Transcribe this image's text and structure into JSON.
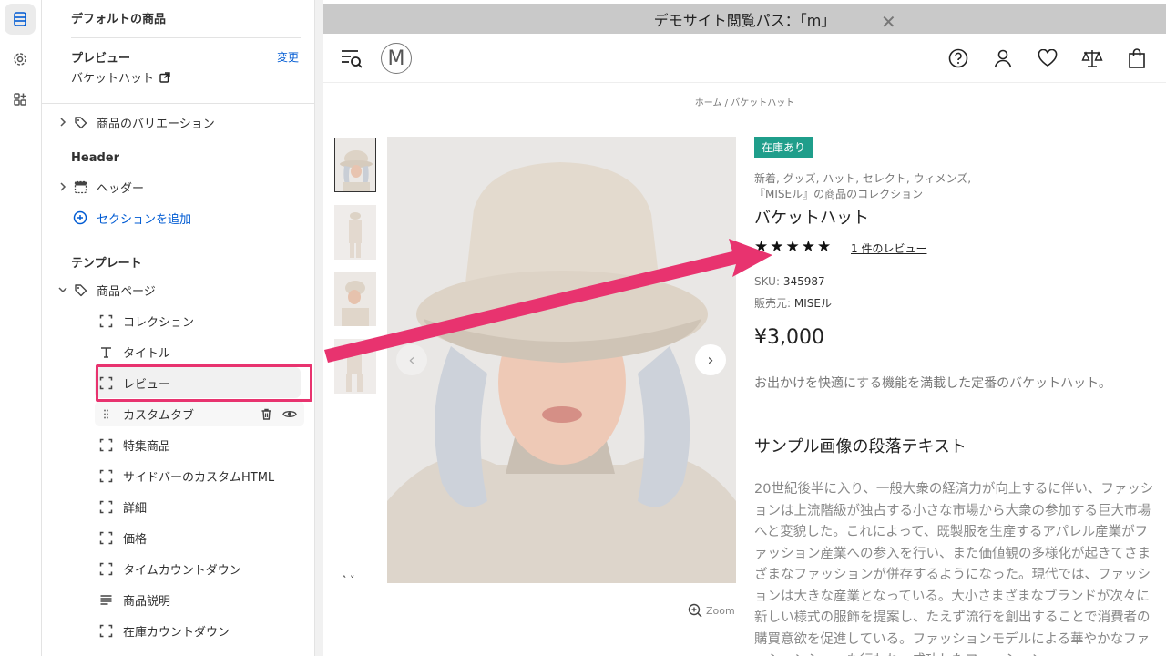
{
  "panel": {
    "title": "デフォルトの商品",
    "preview_label": "プレビュー",
    "preview_change": "変更",
    "preview_product": "バケットハット",
    "variations_label": "商品のバリエーション",
    "header_section_title": "Header",
    "header_item": "ヘッダー",
    "add_section": "セクションを追加",
    "template_title": "テンプレート",
    "product_page": "商品ページ",
    "blocks": [
      {
        "label": "コレクション",
        "icon": "block-icon"
      },
      {
        "label": "タイトル",
        "icon": "text-icon"
      },
      {
        "label": "レビュー",
        "icon": "block-icon"
      },
      {
        "label": "カスタムタブ",
        "icon": "drag-handle-icon"
      },
      {
        "label": "特集商品",
        "icon": "block-icon"
      },
      {
        "label": "サイドバーのカスタムHTML",
        "icon": "block-icon"
      },
      {
        "label": "詳細",
        "icon": "block-icon"
      },
      {
        "label": "価格",
        "icon": "block-icon"
      },
      {
        "label": "タイムカウントダウン",
        "icon": "block-icon"
      },
      {
        "label": "商品説明",
        "icon": "paragraph-icon"
      },
      {
        "label": "在庫カウントダウン",
        "icon": "block-icon"
      }
    ]
  },
  "preview": {
    "demo_banner": "デモサイト閲覧パス：「m」",
    "demo_close": "✕",
    "logo_letter": "M",
    "breadcrumb": "ホーム  /  バケットハット",
    "zoom_label": "Zoom",
    "thumb_arrows": "˄  ˅",
    "product": {
      "stock_badge": "在庫あり",
      "tags_line1": "新着, グッズ, ハット, セレクト, ウィメンズ,",
      "tags_line2": "『MISEル』の商品のコレクション",
      "name": "バケットハット",
      "stars": "★★★★★",
      "rating": 5,
      "review_link": "1 件のレビュー",
      "sku_label": "SKU:",
      "sku_value": "345987",
      "vendor_label": "販売元:",
      "vendor_value": "MISEル",
      "price": "¥3,000",
      "short_desc": "お出かけを快適にする機能を満載した定番のバケットハット。",
      "sample_heading": "サンプル画像の段落テキスト",
      "body_text": "20世紀後半に入り、一般大衆の経済力が向上するに伴い、ファッションは上流階級が独占する小さな市場から大衆の参加する巨大市場へと変貌した。これによって、既製服を生産するアパレル産業がファッション産業への参入を行い、また価値観の多様化が起きてさまざまなファッションが併存するようになった。現代では、ファッションは大きな産業となっている。大小さまざまなブランドが次々に新しい様式の服飾を提案し、たえず流行を創出することで消費者の購買意欲を促進している。ファッションモデルによる華やかなファッションショーも行われ、成功したファッション"
    }
  },
  "colors": {
    "accent_blue": "#005bd3",
    "highlight_pink": "#e8336f",
    "stock_green": "#1f9e8b"
  }
}
